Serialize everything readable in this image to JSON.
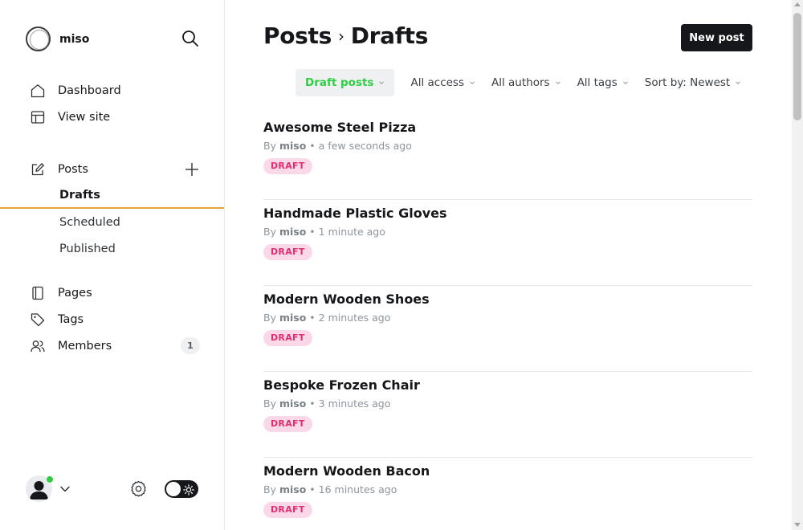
{
  "brand": {
    "name": "miso"
  },
  "sidebar": {
    "main_items": [
      {
        "label": "Dashboard",
        "icon": "home-icon"
      },
      {
        "label": "View site",
        "icon": "layout-icon"
      }
    ],
    "posts": {
      "label": "Posts",
      "icon": "edit-icon",
      "sub_items": [
        {
          "label": "Drafts",
          "active": true
        },
        {
          "label": "Scheduled",
          "active": false
        },
        {
          "label": "Published",
          "active": false
        }
      ]
    },
    "other_items": [
      {
        "label": "Pages",
        "icon": "page-icon"
      },
      {
        "label": "Tags",
        "icon": "tag-icon"
      },
      {
        "label": "Members",
        "icon": "members-icon",
        "count": "1"
      }
    ]
  },
  "header": {
    "breadcrumb_parent": "Posts",
    "breadcrumb_separator": "›",
    "breadcrumb_current": "Drafts",
    "new_post_label": "New post"
  },
  "filters": [
    {
      "label": "Draft posts",
      "active": true
    },
    {
      "label": "All access",
      "active": false
    },
    {
      "label": "All authors",
      "active": false
    },
    {
      "label": "All tags",
      "active": false
    },
    {
      "label": "Sort by: Newest",
      "active": false
    }
  ],
  "posts": [
    {
      "title": "Awesome Steel Pizza",
      "by": "By",
      "author": "miso",
      "time": "• a few seconds ago",
      "status": "DRAFT"
    },
    {
      "title": "Handmade Plastic Gloves",
      "by": "By",
      "author": "miso",
      "time": "• 1 minute ago",
      "status": "DRAFT"
    },
    {
      "title": "Modern Wooden Shoes",
      "by": "By",
      "author": "miso",
      "time": "• 2 minutes ago",
      "status": "DRAFT"
    },
    {
      "title": "Bespoke Frozen Chair",
      "by": "By",
      "author": "miso",
      "time": "• 3 minutes ago",
      "status": "DRAFT"
    },
    {
      "title": "Modern Wooden Bacon",
      "by": "By",
      "author": "miso",
      "time": "• 16 minutes ago",
      "status": "DRAFT"
    }
  ],
  "colors": {
    "accent_green": "#30cf43",
    "draft_pink": "#e0306e",
    "draft_pink_bg": "#fbd8e9",
    "active_underline": "#e2a533",
    "dark": "#15171a"
  }
}
